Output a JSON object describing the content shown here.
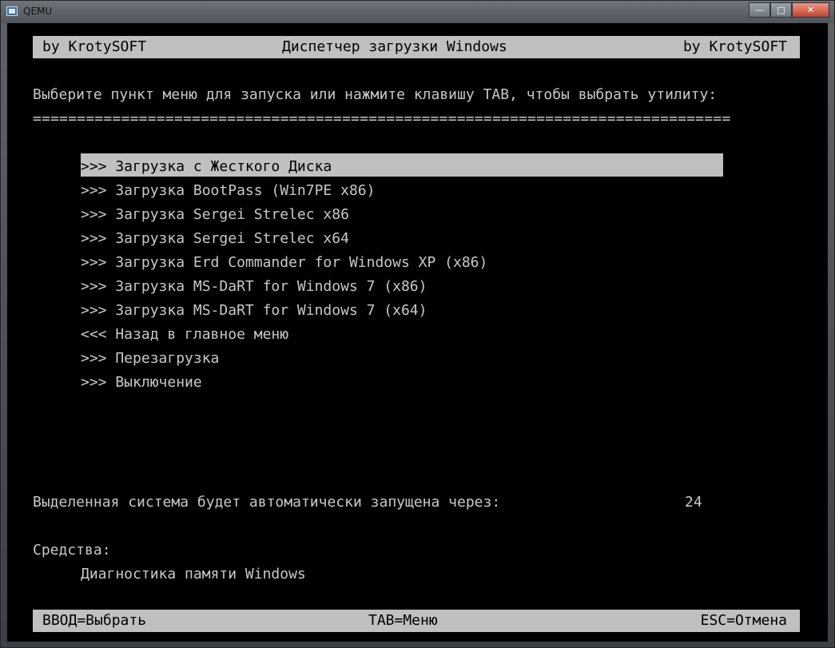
{
  "window": {
    "title": "QEMU",
    "controls": {
      "minimize": "—",
      "maximize": "□",
      "close": "✕"
    }
  },
  "header": {
    "left": "by KrotySOFT",
    "center": "Диспетчер загрузки Windows",
    "right": "by KrotySOFT"
  },
  "prompt": "Выберите пункт меню для запуска или нажмите клавишу TAB, чтобы выбрать утилиту:",
  "separator": "===============================================================================",
  "menu": {
    "selected_index": 0,
    "items": [
      {
        "label": ">>> Загрузка с Жесткого Диска"
      },
      {
        "label": ">>> Загрузка BootPass (Win7PE x86)"
      },
      {
        "label": ">>> Загрузка Sergei Strelec x86"
      },
      {
        "label": ">>> Загрузка Sergei Strelec x64"
      },
      {
        "label": ">>> Загрузка Erd Commander for Windows XP (x86)"
      },
      {
        "label": ">>> Загрузка MS-DaRT for Windows 7 (x86)"
      },
      {
        "label": ">>> Загрузка MS-DaRT for Windows 7 (x64)"
      },
      {
        "label": "<<< Назад в главное меню"
      },
      {
        "label": ">>> Перезагрузка"
      },
      {
        "label": ">>> Выключение"
      }
    ]
  },
  "countdown": {
    "label": "Выделенная система будет автоматически запущена через:",
    "value": "24"
  },
  "tools": {
    "heading": "Средства:",
    "items": [
      "Диагностика памяти Windows"
    ]
  },
  "footer": {
    "left": "ВВОД=Выбрать",
    "center": "TAB=Меню",
    "right": "ESC=Отмена"
  }
}
